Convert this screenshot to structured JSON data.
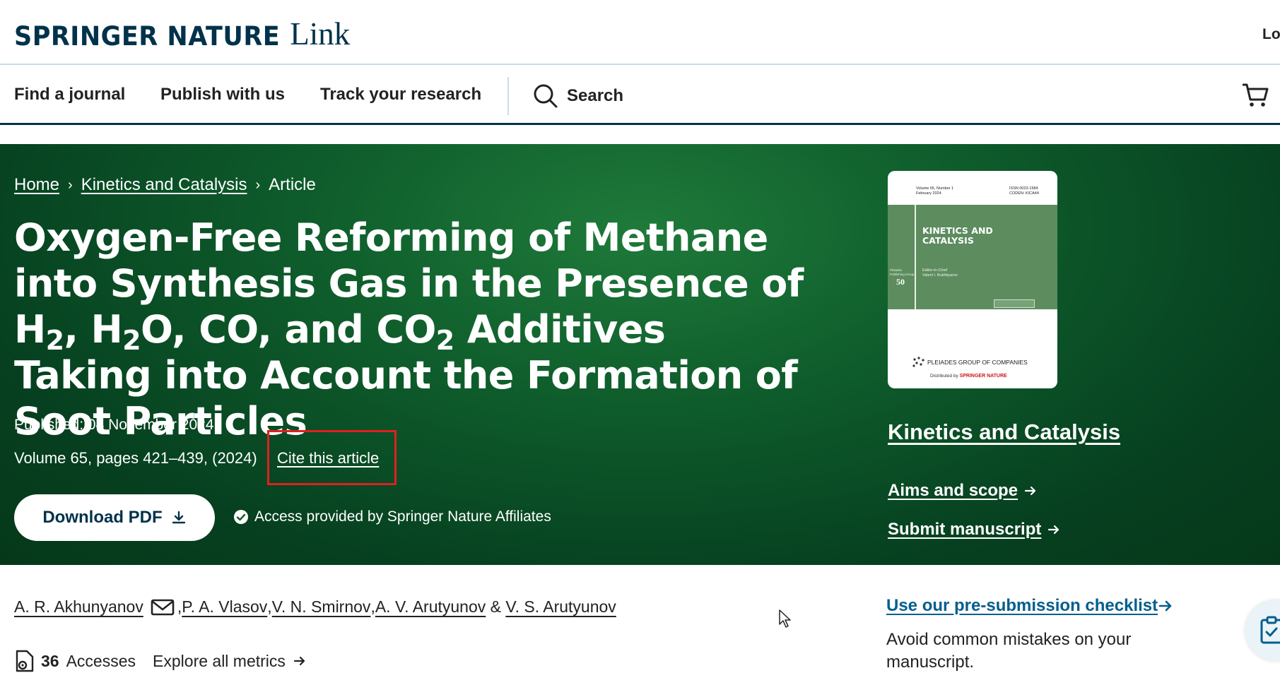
{
  "header": {
    "brand": "SPRINGER NATURE",
    "product": "Link",
    "login_label": "Lo"
  },
  "nav": {
    "items": [
      "Find a journal",
      "Publish with us",
      "Track your research"
    ],
    "search_label": "Search"
  },
  "breadcrumb": {
    "home": "Home",
    "journal": "Kinetics and Catalysis",
    "current": "Article"
  },
  "article": {
    "title_parts": {
      "p1": "Oxygen-Free Reforming of Methane into Synthesis Gas in the Presence of H",
      "s1": "2",
      "p2": ", H",
      "s2": "2",
      "p3": "O, CO, and CO",
      "s3": "2",
      "p4": " Additives Taking into Account the Formation of Soot Particles"
    },
    "published": "Published: 04 November 2024",
    "volume": "Volume 65, pages 421–439, (2024)",
    "cite_label": "Cite this article",
    "download_label": "Download PDF",
    "access_text": "Access provided by Springer Nature Affiliates",
    "authors": [
      "A. R. Akhunyanov",
      "P. A. Vlasov",
      "V. N. Smirnov",
      "A. V. Arutyunov",
      "V. S. Arutyunov"
    ],
    "author_sep": ", ",
    "author_amp": " & ",
    "accesses_count": "36",
    "accesses_label": "Accesses",
    "explore_metrics": "Explore all metrics"
  },
  "journal_panel": {
    "cover": {
      "volume_line": "Volume 65, Number 1",
      "date_line": "February 2024",
      "issn": "ISSN 0023-1584",
      "coden": "CODEN: KICA44",
      "title_line1": "KINETICS AND",
      "title_line2": "CATALYSIS",
      "editor_label": "Editor-in-Chief",
      "editor_name": "Valerii I. Bukhtiyarov",
      "side_text": "Pleiades Publishing Group",
      "anniversary": "50",
      "publisher": "PLEIADES GROUP OF COMPANIES",
      "distributed_by": "Distributed by",
      "distributor": "SPRINGER NATURE"
    },
    "journal_name": "Kinetics and Catalysis",
    "aims_label": "Aims and scope",
    "submit_label": "Submit manuscript",
    "checklist_label": "Use our pre-submission checklist",
    "checklist_desc": "Avoid common mistakes on your manuscript."
  },
  "colors": {
    "brand_navy": "#01324b",
    "hero_green": "#0f5e2c",
    "link_blue": "#025e8d",
    "highlight_red": "#e02020"
  },
  "icons": [
    "search-icon",
    "cart-icon",
    "chevron-right-icon",
    "download-icon",
    "check-circle-icon",
    "arrow-right-icon",
    "mail-icon",
    "metrics-icon",
    "checklist-icon",
    "mouse-cursor-icon"
  ]
}
